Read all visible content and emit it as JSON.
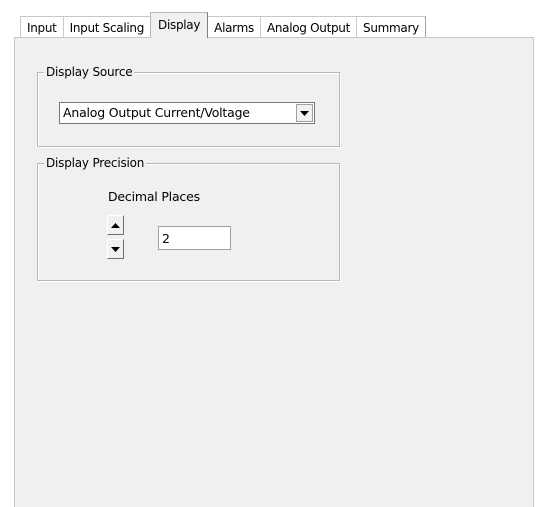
{
  "tabs": [
    {
      "label": "Input",
      "active": false
    },
    {
      "label": "Input Scaling",
      "active": false
    },
    {
      "label": "Display",
      "active": true
    },
    {
      "label": "Alarms",
      "active": false
    },
    {
      "label": "Analog Output",
      "active": false
    },
    {
      "label": "Summary",
      "active": false
    }
  ],
  "display_source": {
    "title": "Display Source",
    "selected_value": "Analog Output Current/Voltage",
    "dropdown_icon": "chevron-down-icon"
  },
  "display_precision": {
    "title": "Display Precision",
    "decimal_places_label": "Decimal Places",
    "decimal_places_value": "2",
    "spin_up_icon": "triangle-up-icon",
    "spin_down_icon": "triangle-down-icon"
  },
  "colors": {
    "panel_background": "#f0f0f0",
    "window_background": "#ffffff",
    "border": "#a0a0a0"
  }
}
